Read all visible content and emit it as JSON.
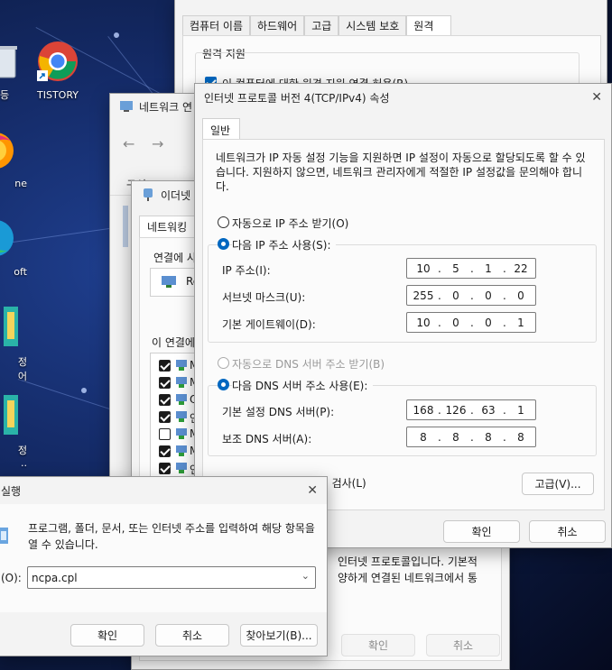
{
  "desktop": {
    "icons": [
      {
        "label": "등",
        "icon": "recycle-bin-icon"
      },
      {
        "label": "TISTORY",
        "icon": "chrome-icon"
      },
      {
        "label": "ne",
        "icon": "firefox-icon"
      },
      {
        "label": "oft",
        "icon": "edge-icon"
      },
      {
        "label": "정",
        "icon": "shortcut-icon"
      },
      {
        "label": "어",
        "icon": ""
      },
      {
        "label": "정",
        "icon": "shortcut-icon"
      },
      {
        "label": "..",
        "icon": ""
      }
    ]
  },
  "sysprops": {
    "tabs": [
      "컴퓨터 이름",
      "하드웨어",
      "고급",
      "시스템 보호",
      "원격"
    ],
    "section": "원격 지원",
    "checkbox_label": "이 컴퓨터에 대한 원격 지원 연결 허용(R)"
  },
  "netconn": {
    "title": "네트워크 연",
    "menu": "구성 ▾"
  },
  "ethprops": {
    "title": "이더넷",
    "tab": "네트워킹",
    "connect_label": "연결에 사",
    "adapter": "Re",
    "list_label": "이 연결에",
    "items": [
      {
        "checked": true,
        "text": "M"
      },
      {
        "checked": true,
        "text": "M"
      },
      {
        "checked": true,
        "text": "Q"
      },
      {
        "checked": true,
        "text": "인"
      },
      {
        "checked": false,
        "text": "M"
      },
      {
        "checked": true,
        "text": "M"
      },
      {
        "checked": true,
        "text": "인"
      }
    ],
    "desc1": "인터넷 프로토콜입니다. 기본적",
    "desc2": "양하게 연결된 네트워크에서 통",
    "ok": "확인",
    "cancel": "취소"
  },
  "tcpip": {
    "title": "인터넷 프로토콜 버전 4(TCP/IPv4) 속성",
    "tab": "일반",
    "desc": "네트워크가 IP 자동 설정 기능을 지원하면 IP 설정이 자동으로 할당되도록 할 수 있습니다. 지원하지 않으면, 네트워크 관리자에게 적절한 IP 설정값을 문의해야 합니다.",
    "auto_ip": "자동으로 IP 주소 받기(O)",
    "manual_ip": "다음 IP 주소 사용(S):",
    "ip_label": "IP 주소(I):",
    "ip": [
      "10",
      "5",
      "1",
      "22"
    ],
    "mask_label": "서브넷 마스크(U):",
    "mask": [
      "255",
      "0",
      "0",
      "0"
    ],
    "gw_label": "기본 게이트웨이(D):",
    "gw": [
      "10",
      "0",
      "0",
      "1"
    ],
    "auto_dns": "자동으로 DNS 서버 주소 받기(B)",
    "manual_dns": "다음 DNS 서버 주소 사용(E):",
    "dns1_label": "기본 설정 DNS 서버(P):",
    "dns1": [
      "168",
      "126",
      "63",
      "1"
    ],
    "dns2_label": "보조 DNS 서버(A):",
    "dns2": [
      "8",
      "8",
      "8",
      "8"
    ],
    "validate": "끝낼 때 설정 유효성 검사(L)",
    "advanced": "고급(V)...",
    "ok": "확인",
    "cancel": "취소"
  },
  "run": {
    "title": "실행",
    "desc": "프로그램, 폴더, 문서, 또는 인터넷 주소를 입력하여 해당 항목을 열 수 있습니다.",
    "open_label": "(O):",
    "input_value": "ncpa.cpl",
    "ok": "확인",
    "cancel": "취소",
    "browse": "찾아보기(B)..."
  }
}
